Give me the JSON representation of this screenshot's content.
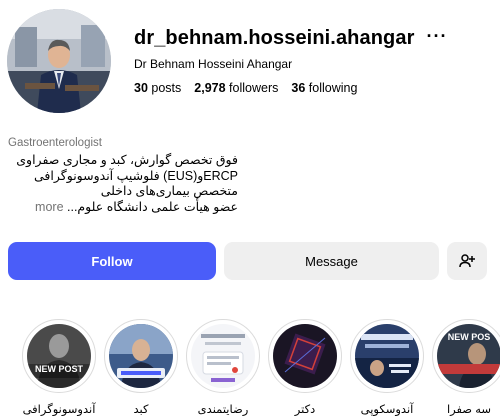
{
  "profile": {
    "username": "dr_behnam.hosseini.ahangar",
    "more_icon": "ellipsis-icon",
    "full_name": "Dr Behnam Hosseini Ahangar",
    "stats": {
      "posts_count": "30",
      "posts_label": "posts",
      "followers_count": "2,978",
      "followers_label": "followers",
      "following_count": "36",
      "following_label": "following"
    },
    "category": "Gastroenterologist",
    "bio_lines": [
      "فوق تخصص گوارش، کبد و مجاری صفراوی",
      "ERCPو(EUS) فلوشیپ آندوسونوگرافی",
      "متخصص بیماری‌های داخلی",
      "عضو هیأت علمی دانشگاه علوم..."
    ],
    "bio_more": "more"
  },
  "actions": {
    "follow_label": "Follow",
    "message_label": "Message",
    "suggest_icon": "add-person-icon",
    "follow_color": "#4a5df9"
  },
  "highlights": [
    {
      "label": "آندوسونوگرافی",
      "badge": "NEW POST"
    },
    {
      "label": "کبد",
      "badge": ""
    },
    {
      "label": "رضایتمندی",
      "badge": ""
    },
    {
      "label": "دکتر",
      "badge": ""
    },
    {
      "label": "آندوسکوپی",
      "badge": ""
    },
    {
      "label": "سه صفرا",
      "badge": "NEW POS"
    }
  ]
}
